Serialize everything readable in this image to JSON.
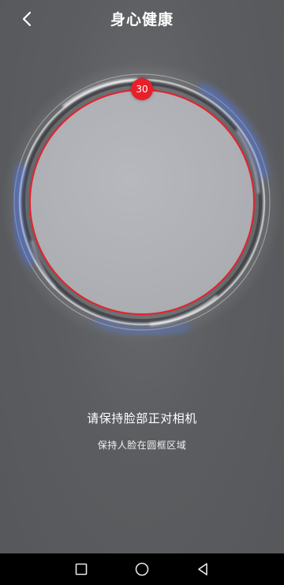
{
  "header": {
    "title": "身心健康",
    "back_icon": "chevron-left-icon"
  },
  "camera": {
    "countdown": "30",
    "ring_color": "#e8202a",
    "glow_color": "#4a78ff"
  },
  "prompts": {
    "main": "请保持脸部正对相机",
    "sub": "保持人脸在圆框区域"
  },
  "nav_bar": {
    "recents_icon": "square-icon",
    "home_icon": "circle-icon",
    "back_icon": "triangle-back-icon"
  }
}
